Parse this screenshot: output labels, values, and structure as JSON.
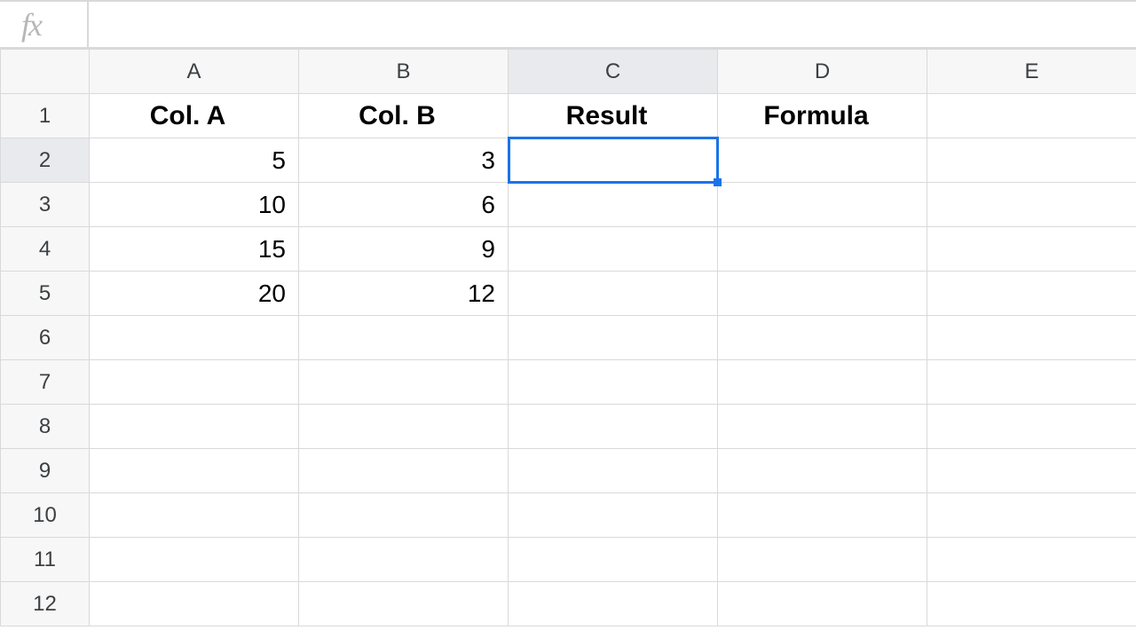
{
  "formula_bar": {
    "fx_label": "fx",
    "value": ""
  },
  "columns": [
    "A",
    "B",
    "C",
    "D",
    "E"
  ],
  "rows": [
    "1",
    "2",
    "3",
    "4",
    "5",
    "6",
    "7",
    "8",
    "9",
    "10",
    "11",
    "12"
  ],
  "selected": {
    "col": "C",
    "row": "2"
  },
  "headers_row": {
    "A": "Col. A",
    "B": "Col. B",
    "C": "Result",
    "D": "Formula",
    "E": ""
  },
  "cells": {
    "A2": "5",
    "B2": "3",
    "A3": "10",
    "B3": "6",
    "A4": "15",
    "B4": "9",
    "A5": "20",
    "B5": "12"
  }
}
